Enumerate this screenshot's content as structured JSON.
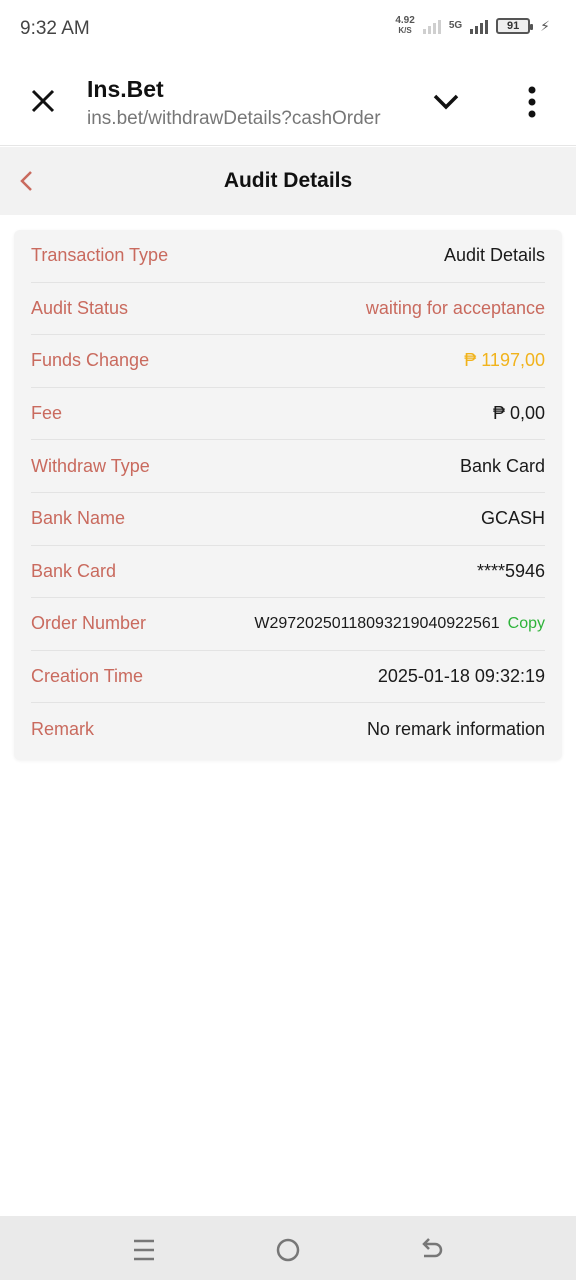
{
  "status_bar": {
    "time": "9:32 AM",
    "net_speed": "4.92",
    "net_unit": "K/S",
    "network_type": "5G",
    "battery": "91"
  },
  "browser": {
    "site_title": "Ins.Bet",
    "url": "ins.bet/withdrawDetails?cashOrder",
    "icons": [
      "close-icon",
      "chevron-down-icon",
      "more-vert-icon"
    ]
  },
  "page": {
    "title": "Audit Details"
  },
  "details": {
    "transaction_type": {
      "label": "Transaction Type",
      "value": "Audit Details"
    },
    "audit_status": {
      "label": "Audit Status",
      "value": "waiting for acceptance"
    },
    "funds_change": {
      "label": "Funds Change",
      "value": "₱ 1197,00"
    },
    "fee": {
      "label": "Fee",
      "value": "₱ 0,00"
    },
    "withdraw_type": {
      "label": "Withdraw Type",
      "value": "Bank Card"
    },
    "bank_name": {
      "label": "Bank Name",
      "value": "GCASH"
    },
    "bank_card": {
      "label": "Bank Card",
      "value": "****5946"
    },
    "order_number": {
      "label": "Order Number",
      "value": "W29720250118093219040922561",
      "copy_label": "Copy"
    },
    "creation_time": {
      "label": "Creation Time",
      "value": "2025-01-18 09:32:19"
    },
    "remark": {
      "label": "Remark",
      "value": "No remark information"
    }
  },
  "colors": {
    "label": "#c96a5e",
    "funds": "#f1b31c",
    "copy": "#2eb33a"
  }
}
